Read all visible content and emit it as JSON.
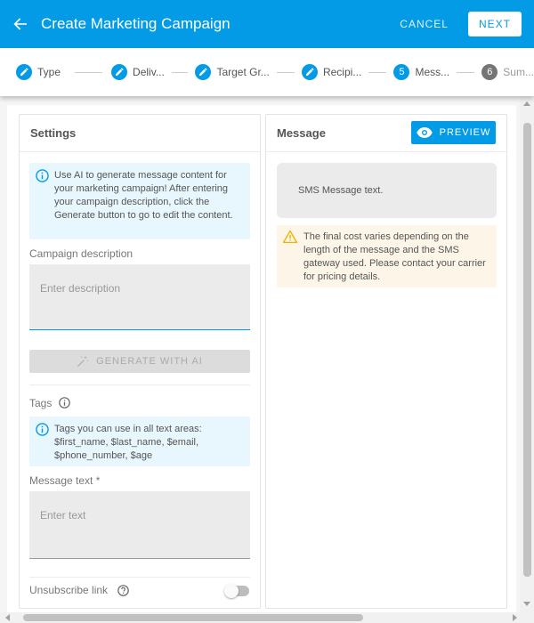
{
  "header": {
    "title": "Create Marketing Campaign",
    "cancel_label": "CANCEL",
    "next_label": "NEXT"
  },
  "steps": [
    {
      "label": "Type",
      "state": "done",
      "number": ""
    },
    {
      "label": "Deliv...",
      "state": "done",
      "number": ""
    },
    {
      "label": "Target Gr...",
      "state": "done",
      "number": ""
    },
    {
      "label": "Recipi...",
      "state": "done",
      "number": ""
    },
    {
      "label": "Mess...",
      "state": "active",
      "number": "5"
    },
    {
      "label": "Sum...",
      "state": "pending",
      "number": "6"
    }
  ],
  "settings": {
    "title": "Settings",
    "ai_info": "Use AI to generate message content for your marketing campaign! After entering your campaign description, click the Generate button to go to edit the content.",
    "description_label": "Campaign description",
    "description_placeholder": "Enter description",
    "generate_label": "GENERATE WITH AI",
    "tags_label": "Tags",
    "tags_info": "Tags you can use in all text areas: $first_name, $last_name, $email, $phone_number, $age",
    "message_label": "Message text *",
    "message_placeholder": "Enter text",
    "unsubscribe_label": "Unsubscribe link"
  },
  "message": {
    "title": "Message",
    "preview_label": "PREVIEW",
    "sms_text": "SMS Message text.",
    "warning": "The final cost varies depending on the length of the message and the SMS gateway used. Please contact your carrier for pricing details."
  },
  "colors": {
    "primary": "#039be5",
    "info_bg": "#e8f6fd",
    "warn_bg": "#fdf6e8",
    "warn_icon": "#f0b400"
  },
  "icons": {
    "back": "arrow-left-icon",
    "done_step": "pencil-icon",
    "info": "info-icon",
    "help": "help-circle-icon",
    "magic": "magic-wand-icon",
    "preview": "eye-icon",
    "warning": "warning-icon"
  }
}
